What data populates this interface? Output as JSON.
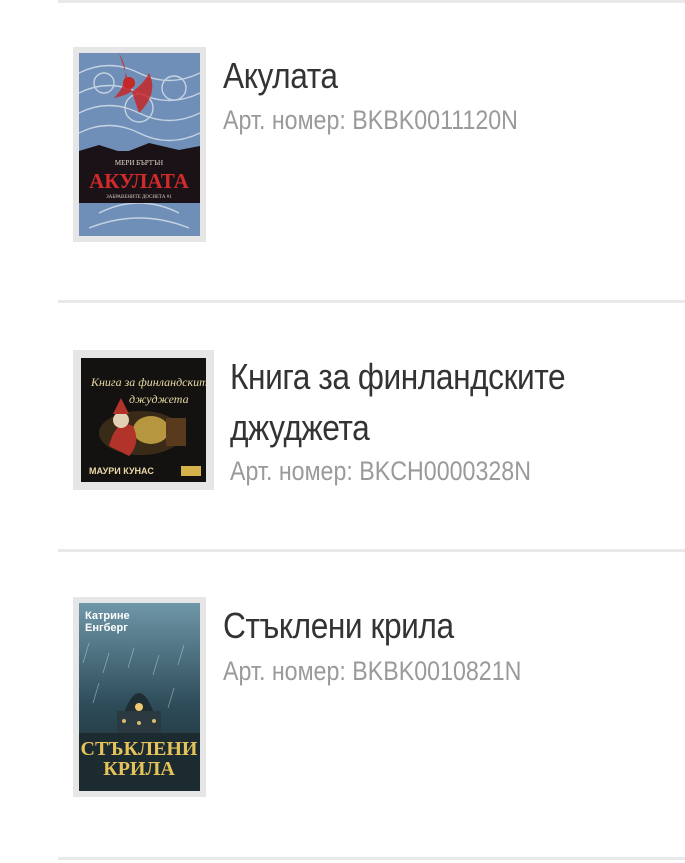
{
  "products": [
    {
      "title_lines": [
        "Акулата"
      ],
      "sku": "Арт. номер: BKBK0011120N",
      "cover": {
        "icon": "book-cover-akulata",
        "text": [
          "МЕРИ БЪРТЪН",
          "АКУЛАТА",
          "ЗАБРАВЕНИТЕ ДОСИЕТА #1"
        ],
        "colors": {
          "bg": "#6f8fb8",
          "band": "#1a1216",
          "accent": "#c62828"
        }
      }
    },
    {
      "title_lines": [
        "Книга за финландските",
        "джуджета"
      ],
      "sku": "Арт. номер: BKCH0000328N",
      "cover": {
        "icon": "book-cover-finnish-dwarves",
        "text": [
          "Книга за финландските",
          "джуджета",
          "МАУРИ КУНАС"
        ],
        "colors": {
          "bg": "#141210",
          "gold": "#d6b24a",
          "accent": "#b2332a"
        }
      }
    },
    {
      "title_lines": [
        "Стъклени крила"
      ],
      "sku": "Арт. номер: BKBK0010821N",
      "cover": {
        "icon": "book-cover-glass-wings",
        "text": [
          "Катрине",
          "Енгберг",
          "СТЪКЛЕНИ",
          "КРИЛА"
        ],
        "colors": {
          "bg": "#2d4b58",
          "gold": "#e6c25a",
          "sky": "#6f97a8"
        }
      }
    }
  ]
}
